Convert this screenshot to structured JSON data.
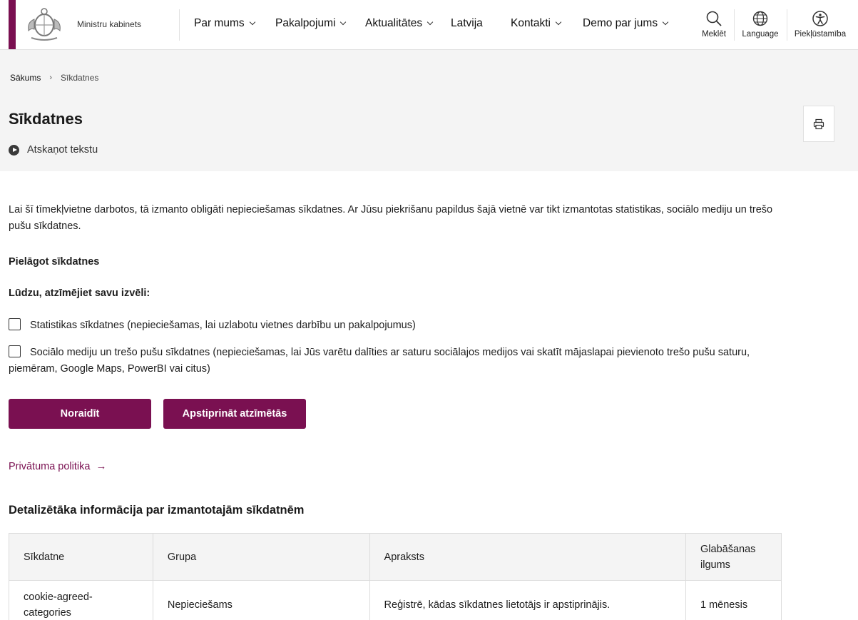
{
  "header": {
    "brand_name": "Ministru kabinets",
    "brand_color": "#7a1051",
    "nav": [
      {
        "label": "Par mums",
        "has_dropdown": true
      },
      {
        "label": "Pakalpojumi",
        "has_dropdown": true
      },
      {
        "label": "Aktualitātes",
        "has_dropdown": true
      },
      {
        "label": "Latvija",
        "has_dropdown": false
      },
      {
        "label": "Kontakti",
        "has_dropdown": true
      },
      {
        "label": "Demo par jums",
        "has_dropdown": true
      }
    ],
    "tools": {
      "search": "Meklēt",
      "language": "Language",
      "accessibility": "Piekļūstamība"
    }
  },
  "breadcrumb": {
    "home": "Sākums",
    "separator": "›",
    "current": "Sīkdatnes"
  },
  "page": {
    "title": "Sīkdatnes",
    "listen_label": "Atskaņot tekstu"
  },
  "content": {
    "intro": "Lai šī tīmekļvietne darbotos, tā izmanto obligāti nepieciešamas sīkdatnes. Ar Jūsu piekrišanu papildus šajā vietnē var tikt izmantotas statistikas, sociālo mediju un trešo pušu sīkdatnes.",
    "customize_heading": "Pielāgot sīkdatnes",
    "choose_heading": "Lūdzu, atzīmējiet savu izvēli:",
    "options": [
      {
        "label": "Statistikas sīkdatnes (nepieciešamas, lai uzlabotu vietnes darbību un pakalpojumus)",
        "checked": false
      },
      {
        "label": "Sociālo mediju un trešo pušu sīkdatnes (nepieciešamas, lai Jūs varētu dalīties ar saturu sociālajos medijos vai skatīt mājaslapai pievienoto trešo pušu saturu, piemēram, Google Maps, PowerBI vai citus)",
        "checked": false
      }
    ],
    "reject_button": "Noraidīt",
    "approve_button": "Apstiprināt atzīmētās",
    "privacy_link": "Privātuma politika",
    "privacy_arrow": "→",
    "details_heading": "Detalizētāka informācija par izmantotajām sīkdatnēm"
  },
  "table": {
    "headers": [
      "Sīkdatne",
      "Grupa",
      "Apraksts",
      "Glabāšanas ilgums"
    ],
    "rows": [
      [
        "cookie-agreed-categories",
        "Nepieciešams",
        "Reģistrē, kādas sīkdatnes lietotājs ir apstiprinājis.",
        "1 mēnesis"
      ]
    ]
  }
}
